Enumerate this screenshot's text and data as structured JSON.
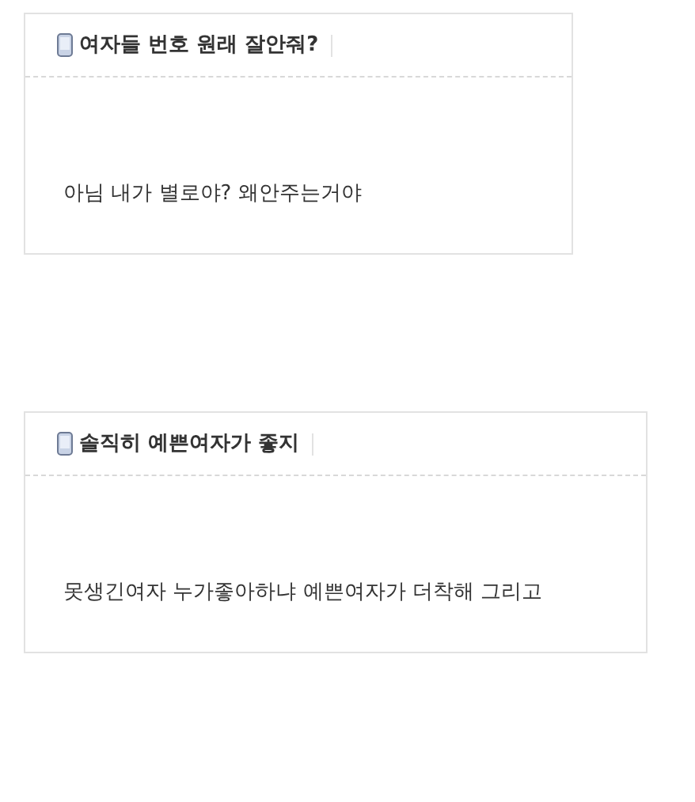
{
  "posts": [
    {
      "title": "여자들 번호 원래 잘안줘?",
      "body": "아님 내가 별로야? 왜안주는거야"
    },
    {
      "title": "솔직히 예쁜여자가 좋지",
      "body": "못생긴여자 누가좋아하냐 예쁜여자가 더착해 그리고"
    }
  ]
}
